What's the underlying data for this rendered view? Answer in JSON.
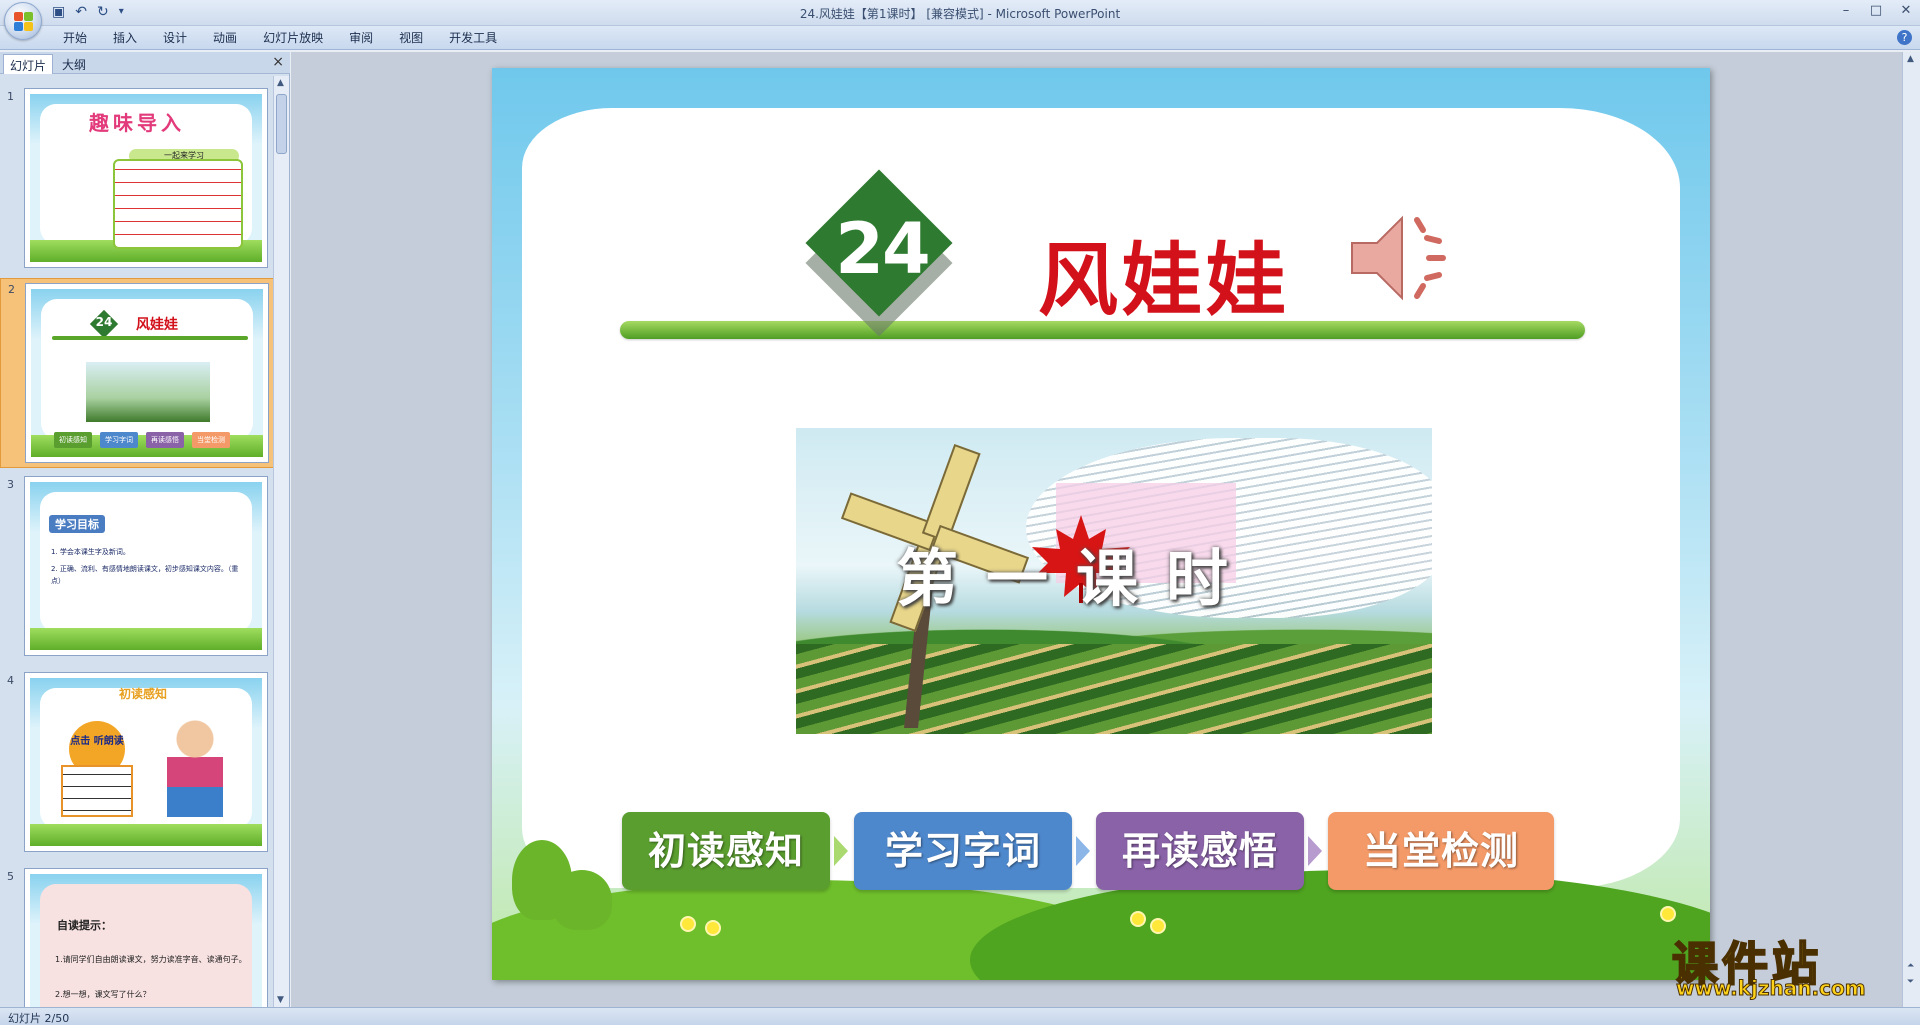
{
  "window": {
    "title": "24.风娃娃【第1课时】 [兼容模式] - Microsoft PowerPoint",
    "controls": [
      "minimize",
      "maximize",
      "close"
    ]
  },
  "quick_access": [
    "save-icon",
    "undo-icon",
    "redo-icon",
    "customize-icon"
  ],
  "ribbon": {
    "tabs": [
      "开始",
      "插入",
      "设计",
      "动画",
      "幻灯片放映",
      "审阅",
      "视图",
      "开发工具"
    ],
    "help_label": "?"
  },
  "slides_pane": {
    "tabs": [
      "幻灯片",
      "大纲"
    ],
    "close_label": "×",
    "thumbnails": [
      {
        "number": "1",
        "title": "趣味导入",
        "subtitle": "一起来学习"
      },
      {
        "number": "2",
        "title": "风娃娃",
        "lesson": "24",
        "steps": [
          "初读感知",
          "学习字词",
          "再读感悟",
          "当堂检测"
        ]
      },
      {
        "number": "3",
        "title": "学习目标",
        "items": [
          "1. 学会本课生字及新词。",
          "2. 正确、流利、有感情地朗读课文，初步感知课文内容。（重点）"
        ]
      },
      {
        "number": "4",
        "title": "初读感知",
        "button": "点击 听朗读"
      },
      {
        "number": "5",
        "title": "自读提示：",
        "items": [
          "1.请同学们自由朗读课文，努力读准字音、读通句子。",
          "2.想一想，课文写了什么？"
        ]
      }
    ],
    "selected_index": 2
  },
  "slide": {
    "lesson_number": "24",
    "title": "风娃娃",
    "lesson_time": "第一课时",
    "steps": [
      {
        "label": "初读感知",
        "color": "#5a9e2f"
      },
      {
        "label": "学习字词",
        "color": "#4e88cc"
      },
      {
        "label": "再读感悟",
        "color": "#8a62a8"
      },
      {
        "label": "当堂检测",
        "color": "#f49a68"
      }
    ],
    "title_color": "#d2111b",
    "accent_green": "#2f7a31"
  },
  "watermark": {
    "name": "课件站",
    "url": "www.kjzhan.com"
  },
  "status": {
    "slide_info": "幻灯片 2/50"
  }
}
